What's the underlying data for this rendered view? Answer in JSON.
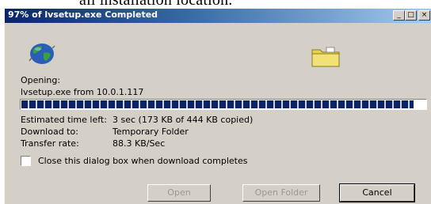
{
  "caption": {
    "text": "all installation location."
  },
  "window": {
    "title": "97% of lvsetup.exe Completed",
    "controls": {
      "minimize": "_",
      "maximize": "□",
      "close": "×"
    }
  },
  "icons": {
    "globe": "globe-icon",
    "folder": "folder-icon"
  },
  "status": {
    "opening_label": "Opening:",
    "file_line": "lvsetup.exe from 10.0.1.117",
    "progress_percent": 97
  },
  "details": [
    {
      "label": "Estimated time left:",
      "value": "3 sec (173 KB of 444 KB copied)"
    },
    {
      "label": "Download to:",
      "value": "Temporary Folder"
    },
    {
      "label": "Transfer rate:",
      "value": "88.3 KB/Sec"
    }
  ],
  "options": {
    "close_when_done": "Close this dialog box when download completes"
  },
  "buttons": {
    "open": "Open",
    "open_folder": "Open Folder",
    "cancel": "Cancel"
  },
  "colors": {
    "titlebar": "#0a246a",
    "dialog": "#d4d0c8",
    "progress": "#0a246a"
  }
}
